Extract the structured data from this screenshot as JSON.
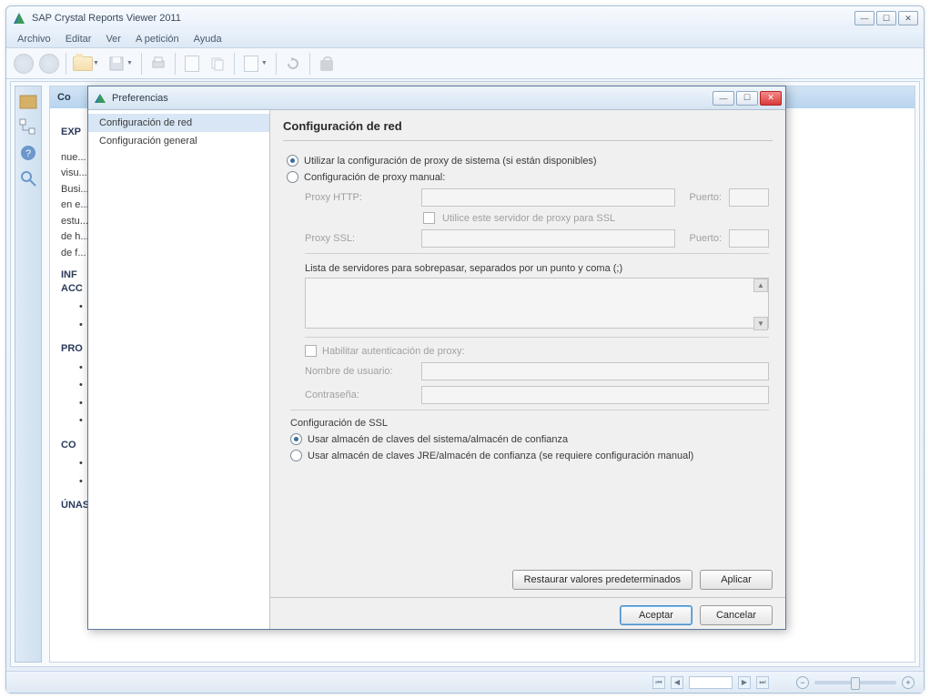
{
  "main_window": {
    "title": "SAP Crystal Reports Viewer 2011",
    "menubar": [
      "Archivo",
      "Editar",
      "Ver",
      "A petición",
      "Ayuda"
    ],
    "content_tab": "Co",
    "content": {
      "heading1": "EXP",
      "lines": [
        "nue...",
        "visu...",
        "Busi...",
        "en e...",
        "estu...",
        "de h...",
        "de f..."
      ],
      "heading2": "INF",
      "heading2b": "ACC",
      "heading3": "PRO",
      "heading4": "CO",
      "heading5": "ÚNASE A NUESTRA"
    }
  },
  "dialog": {
    "title": "Preferencias",
    "sidebar": [
      "Configuración de red",
      "Configuración general"
    ],
    "page_title": "Configuración de red",
    "radio_system_proxy": "Utilizar la configuración de proxy de sistema (si están disponibles)",
    "radio_manual_proxy": "Configuración de proxy manual:",
    "proxy_http_label": "Proxy HTTP:",
    "port_label": "Puerto:",
    "use_for_ssl": "Utilice este servidor de proxy para SSL",
    "proxy_ssl_label": "Proxy SSL:",
    "bypass_label": "Lista de servidores para sobrepasar, separados por un punto y coma (;)",
    "enable_auth": "Habilitar autenticación de proxy:",
    "username_label": "Nombre de usuario:",
    "password_label": "Contraseña:",
    "ssl_group": "Configuración de SSL",
    "ssl_system": "Usar almacén de claves del sistema/almacén de confianza",
    "ssl_jre": "Usar almacén de claves JRE/almacén de confianza (se requiere configuración manual)",
    "btn_restore": "Restaurar valores predeterminados",
    "btn_apply": "Aplicar",
    "btn_ok": "Aceptar",
    "btn_cancel": "Cancelar"
  }
}
